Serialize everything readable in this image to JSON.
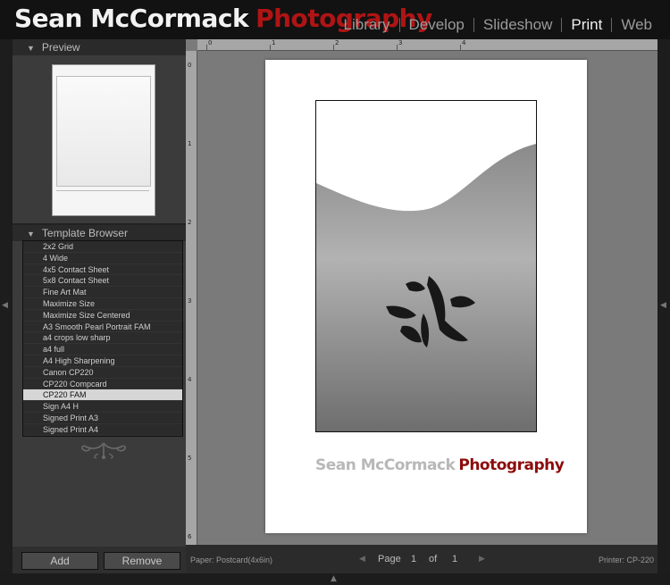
{
  "identity": {
    "part1": "Sean McCormack",
    "part2": "Photography"
  },
  "modules": [
    {
      "label": "Library",
      "active": false
    },
    {
      "label": "Develop",
      "active": false
    },
    {
      "label": "Slideshow",
      "active": false
    },
    {
      "label": "Print",
      "active": true
    },
    {
      "label": "Web",
      "active": false
    }
  ],
  "preview_panel": {
    "title": "Preview"
  },
  "template_browser": {
    "title": "Template Browser",
    "items": [
      {
        "label": "2x2 Grid"
      },
      {
        "label": "4 Wide"
      },
      {
        "label": "4x5 Contact Sheet"
      },
      {
        "label": "5x8 Contact Sheet"
      },
      {
        "label": "Fine Art Mat"
      },
      {
        "label": "Maximize Size"
      },
      {
        "label": "Maximize Size Centered"
      },
      {
        "label": "A3 Smooth Pearl Portrait FAM"
      },
      {
        "label": "a4 crops low sharp"
      },
      {
        "label": "a4 full"
      },
      {
        "label": "A4 High Sharpening"
      },
      {
        "label": "Canon CP220"
      },
      {
        "label": "CP220 Compcard"
      },
      {
        "label": "CP220 FAM",
        "selected": true
      },
      {
        "label": "Sign A4 H"
      },
      {
        "label": "Signed Print A3"
      },
      {
        "label": "Signed Print A4"
      }
    ]
  },
  "buttons": {
    "add": "Add",
    "remove": "Remove"
  },
  "identity_plate": {
    "part1": "Sean McCormack",
    "part2": "Photography"
  },
  "ruler": {
    "top": [
      "0",
      "1",
      "2",
      "3",
      "4"
    ],
    "left": [
      "0",
      "1",
      "2",
      "3",
      "4",
      "5",
      "6"
    ]
  },
  "status": {
    "paper": "Paper: Postcard(4x6in)",
    "page_label": "Page",
    "page": "1",
    "of_label": "of",
    "total": "1",
    "printer": "Printer: CP-220"
  },
  "colors": {
    "accent_red": "#b01414",
    "selected_row": "#d6d6d6",
    "canvas": "#7a7a7a"
  }
}
